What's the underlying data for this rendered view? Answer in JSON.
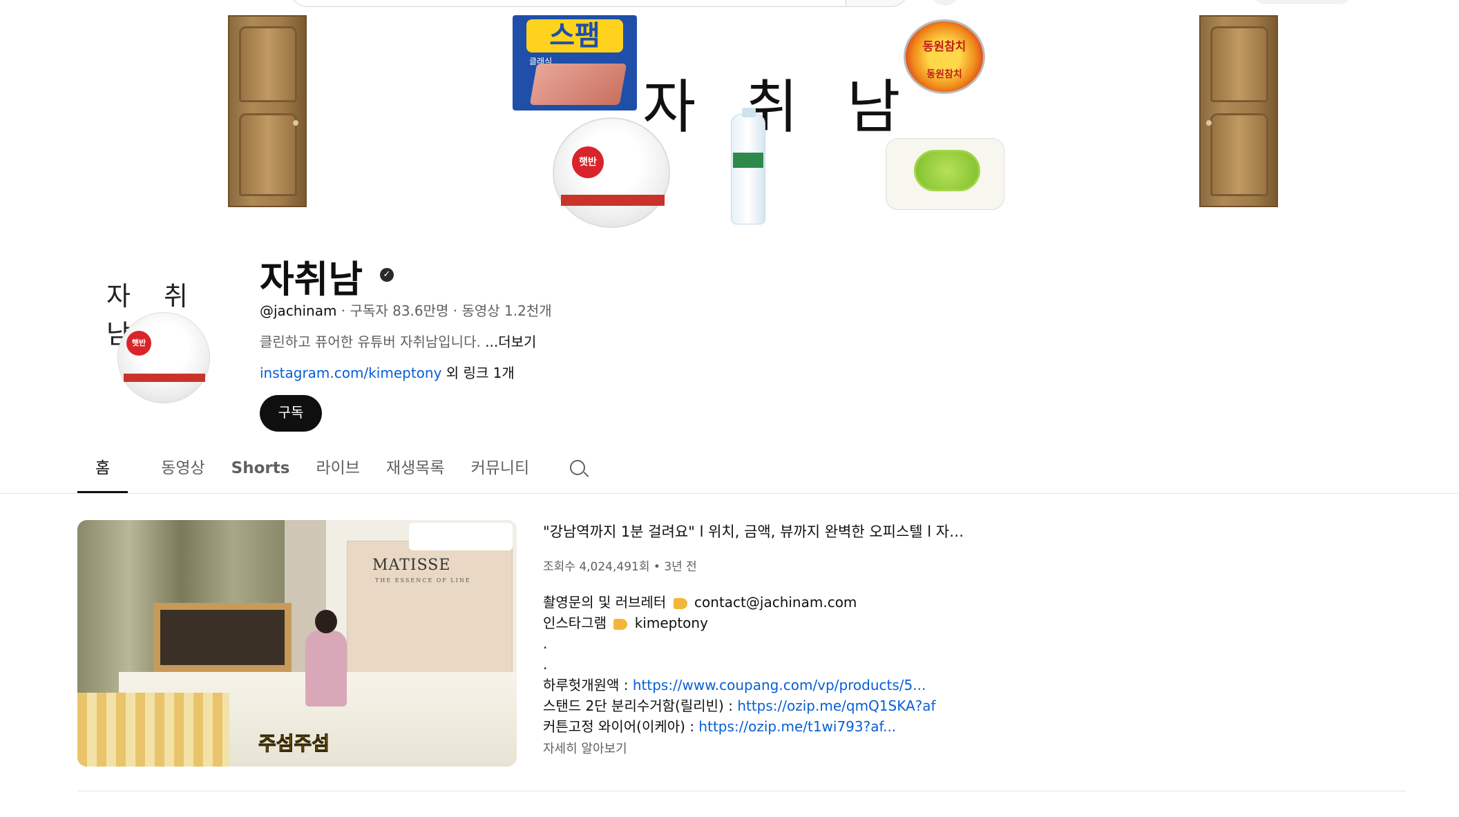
{
  "banner": {
    "title": "자 취 남",
    "spam_label": "스팸",
    "spam_sub": "클래식",
    "tuna_label": "동원참치",
    "rice_label": "햇반"
  },
  "channel": {
    "name": "자취남",
    "verified_icon": "check-circle-icon",
    "handle": "@jachinam",
    "meta": " · 구독자 83.6만명 · 동영상 1.2천개",
    "description": "클린하고 퓨어한 유튜버 자취남입니다. ",
    "description_more": "...더보기",
    "link_url": "instagram.com/kimeptony",
    "link_extra": " 외 링크 1개",
    "subscribe_label": "구독",
    "avatar_text": "자 취 남"
  },
  "tabs": [
    {
      "label": "홈"
    },
    {
      "label": "동영상"
    },
    {
      "label": "Shorts"
    },
    {
      "label": "라이브"
    },
    {
      "label": "재생목록"
    },
    {
      "label": "커뮤니티"
    }
  ],
  "featured": {
    "title": "\"강남역까지 1분 걸려요\" l 위치, 금액, 뷰까지 완벽한 오피스텔 l 자취남",
    "meta": "조회수 4,024,491회 • 3년 전",
    "thumb_brand": "MATISSE",
    "thumb_sub": "THE ESSENCE OF LINE",
    "thumb_caption": "주섬주섬",
    "desc": {
      "line1_prefix": "촬영문의 및 러브레터 ",
      "line1_value": "contact@jachinam.com",
      "line2_prefix": "인스타그램 ",
      "line2_value": "kimeptony",
      "dot1": ".",
      "dot2": ".",
      "item1_label": "하루헛개원액 : ",
      "item1_link": "https://www.coupang.com/vp/products/5...",
      "item2_label": "스탠드 2단 분리수거함(릴리빈) : ",
      "item2_link": "https://ozip.me/qmQ1SKA?af",
      "item3_label": "커튼고정 와이어(이케아) : ",
      "item3_link": "https://ozip.me/t1wi793?af..."
    },
    "more_label": "자세히 알아보기"
  }
}
